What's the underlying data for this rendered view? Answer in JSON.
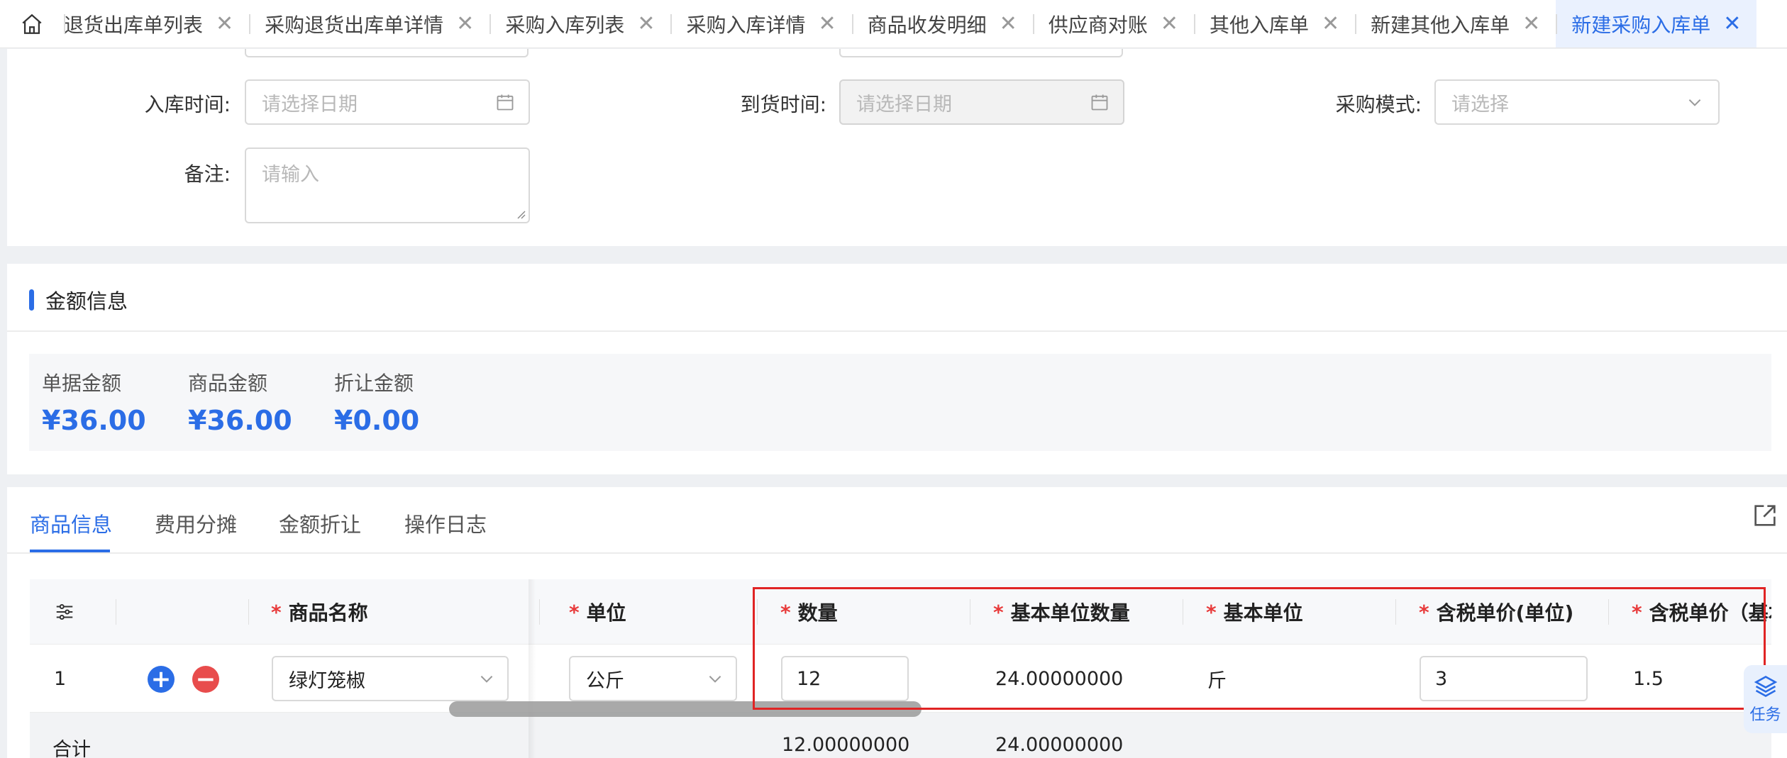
{
  "tabs": [
    {
      "label": "退货出库单列表"
    },
    {
      "label": "采购退货出库单详情"
    },
    {
      "label": "采购入库列表"
    },
    {
      "label": "采购入库详情"
    },
    {
      "label": "商品收发明细"
    },
    {
      "label": "供应商对账"
    },
    {
      "label": "其他入库单"
    },
    {
      "label": "新建其他入库单"
    },
    {
      "label": "新建采购入库单"
    }
  ],
  "form": {
    "inbound_time_label": "入库时间:",
    "inbound_time_placeholder": "请选择日期",
    "arrival_time_label": "到货时间:",
    "arrival_time_placeholder": "请选择日期",
    "purchase_mode_label": "采购模式:",
    "purchase_mode_placeholder": "请选择",
    "remark_label": "备注:",
    "remark_placeholder": "请输入"
  },
  "amount": {
    "title": "金额信息",
    "items": [
      {
        "label": "单据金额",
        "value": "¥36.00"
      },
      {
        "label": "商品金额",
        "value": "¥36.00"
      },
      {
        "label": "折让金额",
        "value": "¥0.00"
      }
    ]
  },
  "product_tabs": [
    {
      "label": "商品信息",
      "active": true
    },
    {
      "label": "费用分摊",
      "active": false
    },
    {
      "label": "金额折让",
      "active": false
    },
    {
      "label": "操作日志",
      "active": false
    }
  ],
  "table": {
    "required_mark": "*",
    "headers": {
      "product_name": "商品名称",
      "unit": "单位",
      "quantity": "数量",
      "base_quantity": "基本单位数量",
      "base_unit": "基本单位",
      "tax_price_unit": "含税单价(单位)",
      "tax_price_base": "含税单价（基本"
    },
    "rows": [
      {
        "index": "1",
        "product_name": "绿灯笼椒",
        "unit": "公斤",
        "quantity": "12",
        "base_quantity": "24.00000000",
        "base_unit": "斤",
        "tax_price_unit": "3",
        "tax_price_base": "1.5"
      }
    ],
    "footer": {
      "label": "合计",
      "quantity": "12.00000000",
      "base_quantity": "24.00000000"
    }
  },
  "floating": {
    "label": "任务"
  },
  "colors": {
    "accent": "#2b6de6",
    "danger": "#e84c4c",
    "highlight": "#e02424"
  }
}
